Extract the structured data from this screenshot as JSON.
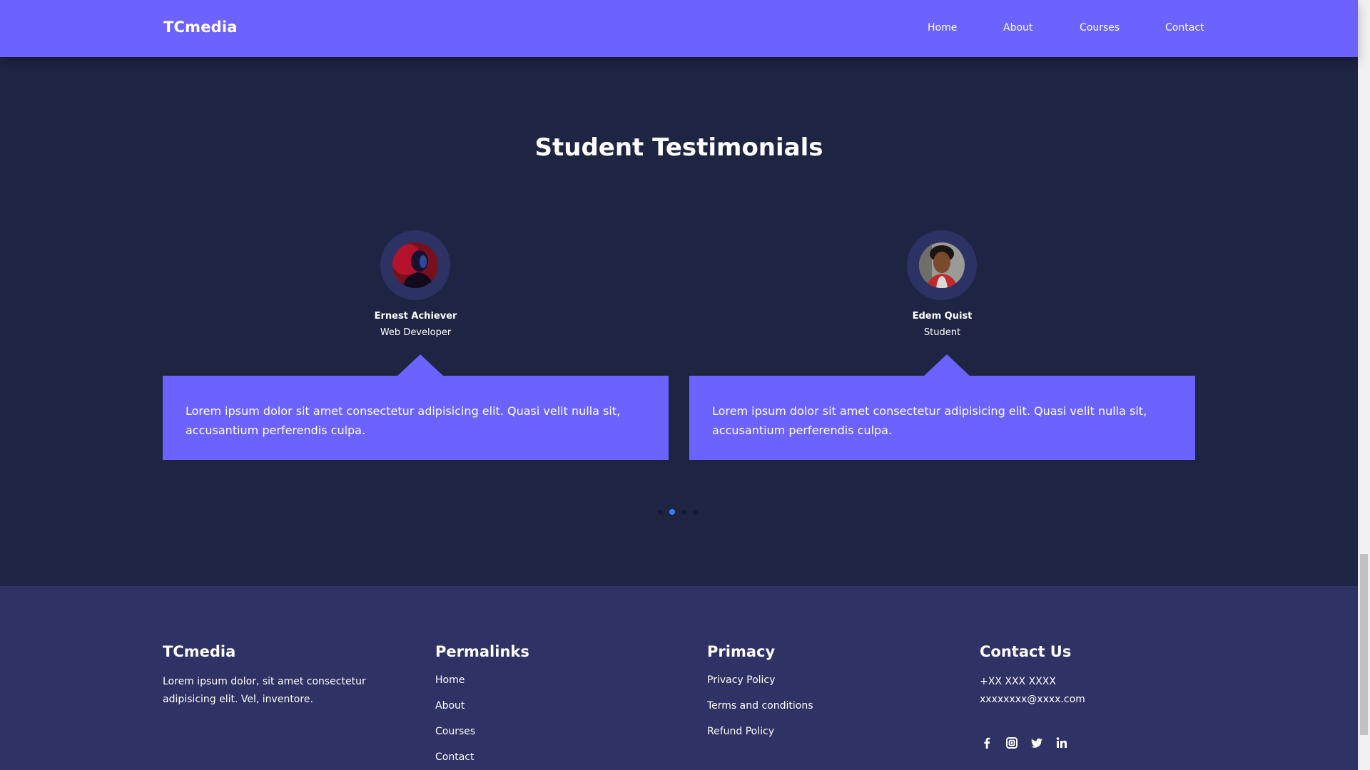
{
  "navbar": {
    "brand": "TCmedia",
    "links": [
      "Home",
      "About",
      "Courses",
      "Contact"
    ]
  },
  "testimonials": {
    "title": "Student Testimonials",
    "items": [
      {
        "name": "Ernest Achiever",
        "role": "Web Developer",
        "quote": "Lorem ipsum dolor sit amet consectetur adipisicing elit. Quasi velit nulla sit, accusantium perferendis culpa."
      },
      {
        "name": "Edem Quist",
        "role": "Student",
        "quote": "Lorem ipsum dolor sit amet consectetur adipisicing elit. Quasi velit nulla sit, accusantium perferendis culpa."
      }
    ],
    "dots": {
      "count": 4,
      "active_index": 1
    }
  },
  "footer": {
    "about": {
      "title": "TCmedia",
      "text": "Lorem ipsum dolor, sit amet consectetur adipisicing elit. Vel, inventore."
    },
    "permalinks": {
      "title": "Permalinks",
      "links": [
        "Home",
        "About",
        "Courses",
        "Contact"
      ]
    },
    "privacy": {
      "title": "Primacy",
      "links": [
        "Privacy Policy",
        "Terms and conditions",
        "Refund Policy"
      ]
    },
    "contact": {
      "title": "Contact Us",
      "phone": "+XX XXX XXXX",
      "email": "xxxxxxxx@xxxx.com",
      "socials": [
        "facebook-icon",
        "instagram-icon",
        "twitter-icon",
        "linkedin-icon"
      ]
    }
  },
  "colors": {
    "accent": "#6c63ff",
    "page_bg": "#1e2542",
    "footer_bg": "#2e3264",
    "dot_active": "#3b82f6"
  }
}
